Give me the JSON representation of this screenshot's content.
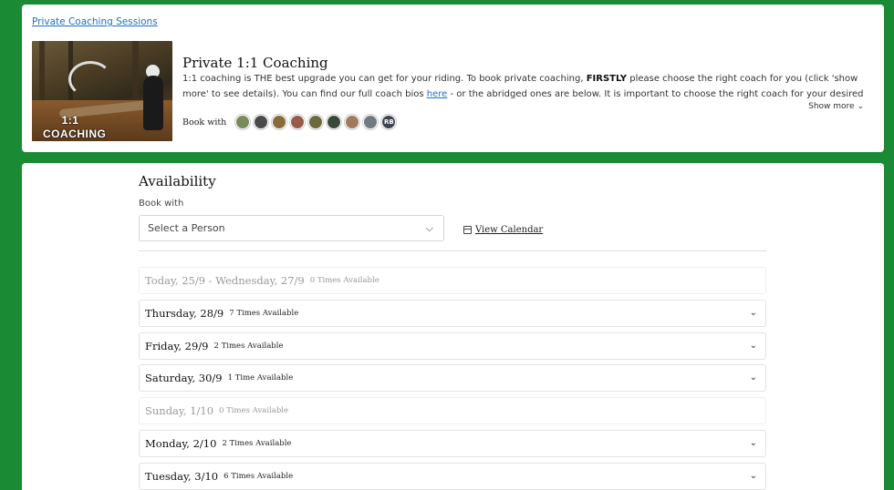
{
  "header": {
    "breadcrumb": "Private Coaching Sessions",
    "hero_text": "1:1 COACHING",
    "title": "Private 1:1 Coaching",
    "desc_part1": "1:1 coaching is THE best upgrade you can get for your riding. To book private coaching, ",
    "desc_bold": "FIRSTLY",
    "desc_part2": " please choose the right coach for you (click 'show more' to see details). You can find our full coach bios ",
    "desc_link": "here",
    "desc_part3": " - or the abridged ones are below. It is important to choose the right coach for your desired outcomes. If you're a beginner or intermediate - I...",
    "show_more": "Show more",
    "book_with": "Book with",
    "avatars": [
      {
        "color": "#7a8a5a"
      },
      {
        "color": "#4a4a4a"
      },
      {
        "color": "#8a6a3a"
      },
      {
        "color": "#9a5a4a"
      },
      {
        "color": "#6a6a3a"
      },
      {
        "color": "#3a4a3a"
      },
      {
        "color": "#a07a5a"
      },
      {
        "color": "#707a80"
      },
      {
        "initials": "RB"
      }
    ]
  },
  "availability": {
    "title": "Availability",
    "book_with_label": "Book with",
    "select_placeholder": "Select a Person",
    "view_calendar": "View Calendar",
    "days": [
      {
        "date": "Today, 25/9 - Wednesday, 27/9",
        "count": "0 Times Available",
        "available": false
      },
      {
        "date": "Thursday, 28/9",
        "count": "7 Times Available",
        "available": true
      },
      {
        "date": "Friday, 29/9",
        "count": "2 Times Available",
        "available": true
      },
      {
        "date": "Saturday, 30/9",
        "count": "1 Time Available",
        "available": true
      },
      {
        "date": "Sunday, 1/10",
        "count": "0 Times Available",
        "available": false
      },
      {
        "date": "Monday, 2/10",
        "count": "2 Times Available",
        "available": true
      },
      {
        "date": "Tuesday, 3/10",
        "count": "6 Times Available",
        "available": true
      }
    ]
  }
}
